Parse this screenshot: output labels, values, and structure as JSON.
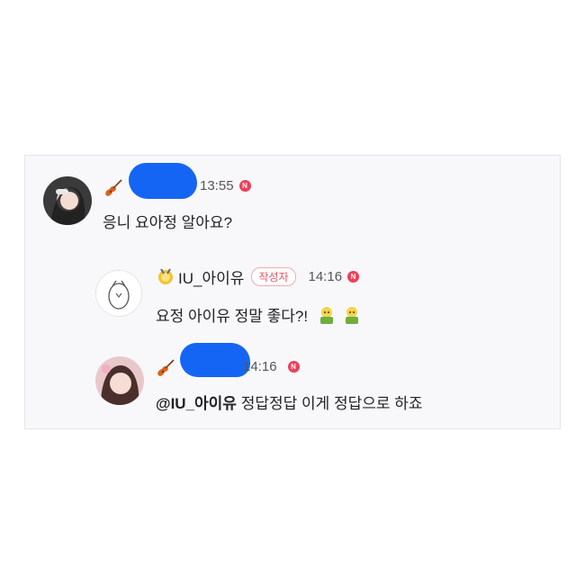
{
  "comments": [
    {
      "time": "13:55",
      "new_badge": "N",
      "text": "응니 요아정 알아요?"
    },
    {
      "nickname": "IU_아이유",
      "author_tag": "작성자",
      "time": "14:16",
      "new_badge": "N",
      "text": "요정 아이유 정말 좋다?!"
    },
    {
      "time": "14:16",
      "new_badge": "N",
      "mention": "@IU_아이유",
      "text": "정답정답 이게 정답으로 하죠"
    }
  ],
  "colors": {
    "redaction": "#1565f5",
    "new_badge": "#f03e57",
    "author_tag": "#f04f5f"
  },
  "icons": [
    "violin-icon",
    "medal-icon",
    "new-badge-icon",
    "emoji-icon"
  ]
}
